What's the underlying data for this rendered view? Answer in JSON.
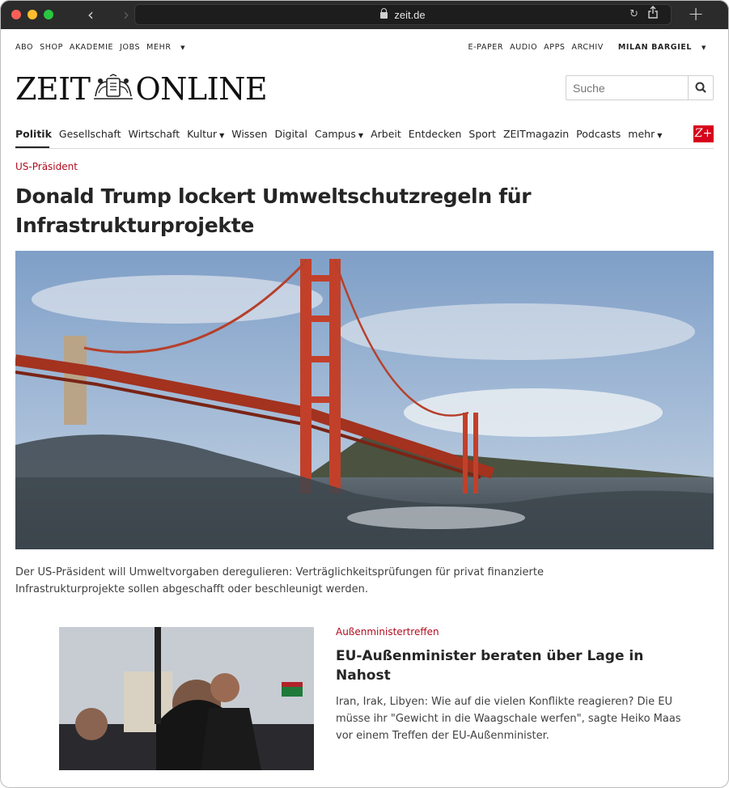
{
  "browser": {
    "url": "zeit.de"
  },
  "utility_nav": {
    "left": [
      "ABO",
      "SHOP",
      "AKADEMIE",
      "JOBS",
      "MEHR"
    ],
    "right": [
      "E-PAPER",
      "AUDIO",
      "APPS",
      "ARCHIV"
    ],
    "user": "MILAN BARGIEL"
  },
  "logo": {
    "left": "ZEIT",
    "right": "ONLINE"
  },
  "search": {
    "placeholder": "Suche"
  },
  "main_nav": {
    "items": [
      "Politik",
      "Gesellschaft",
      "Wirtschaft",
      "Kultur",
      "Wissen",
      "Digital",
      "Campus",
      "Arbeit",
      "Entdecken",
      "Sport",
      "ZEITmagazin",
      "Podcasts",
      "mehr"
    ],
    "active": "Politik",
    "zplus": "Z+"
  },
  "lead_article": {
    "kicker": "US-Präsident",
    "headline": "Donald Trump lockert Umweltschutzregeln für Infrastrukturprojekte",
    "teaser": "Der US-Präsident will Umweltvorgaben deregulieren: Verträglichkeitsprüfungen für privat finanzierte Infrastrukturprojekte sollen abgeschafft oder beschleunigt werden."
  },
  "second_article": {
    "kicker": "Außenministertreffen",
    "headline": "EU-Außenminister beraten über Lage in Nahost",
    "teaser": "Iran, Irak, Libyen: Wie auf die vielen Konflikte reagieren? Die EU müsse ihr \"Gewicht in die Waagschale werfen\", sagte Heiko Maas vor einem Treffen der EU-Außenminister."
  },
  "colors": {
    "accent_red": "#b00b1e",
    "zplus_red": "#d6001c",
    "chrome": "#2b2b2b"
  }
}
